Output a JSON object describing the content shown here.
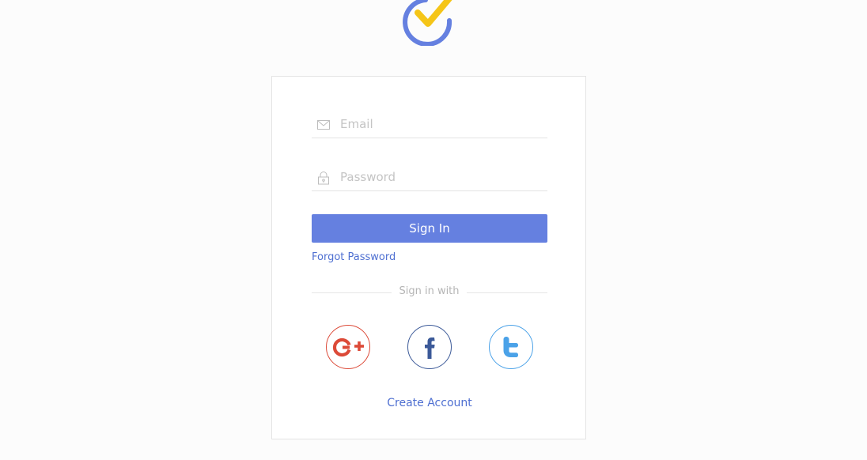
{
  "logo": {
    "icon": "checkmark-logo-icon",
    "ring_color": "#6580e0",
    "check_color": "#f5c518"
  },
  "form": {
    "email": {
      "placeholder": "Email",
      "value": "",
      "icon": "envelope-icon"
    },
    "password": {
      "placeholder": "Password",
      "value": "",
      "icon": "lock-icon"
    },
    "sign_in_label": "Sign In",
    "forgot_label": "Forgot Password"
  },
  "social": {
    "divider_label": "Sign in with",
    "providers": [
      {
        "icon": "google-plus-icon",
        "color": "#dc4a38"
      },
      {
        "icon": "facebook-icon",
        "color": "#3b5998"
      },
      {
        "icon": "twitter-icon",
        "color": "#4ba2e8"
      }
    ]
  },
  "create_account_label": "Create Account",
  "colors": {
    "primary": "#6580e0",
    "link": "#4e6fd1",
    "background": "#fcfcfc"
  }
}
